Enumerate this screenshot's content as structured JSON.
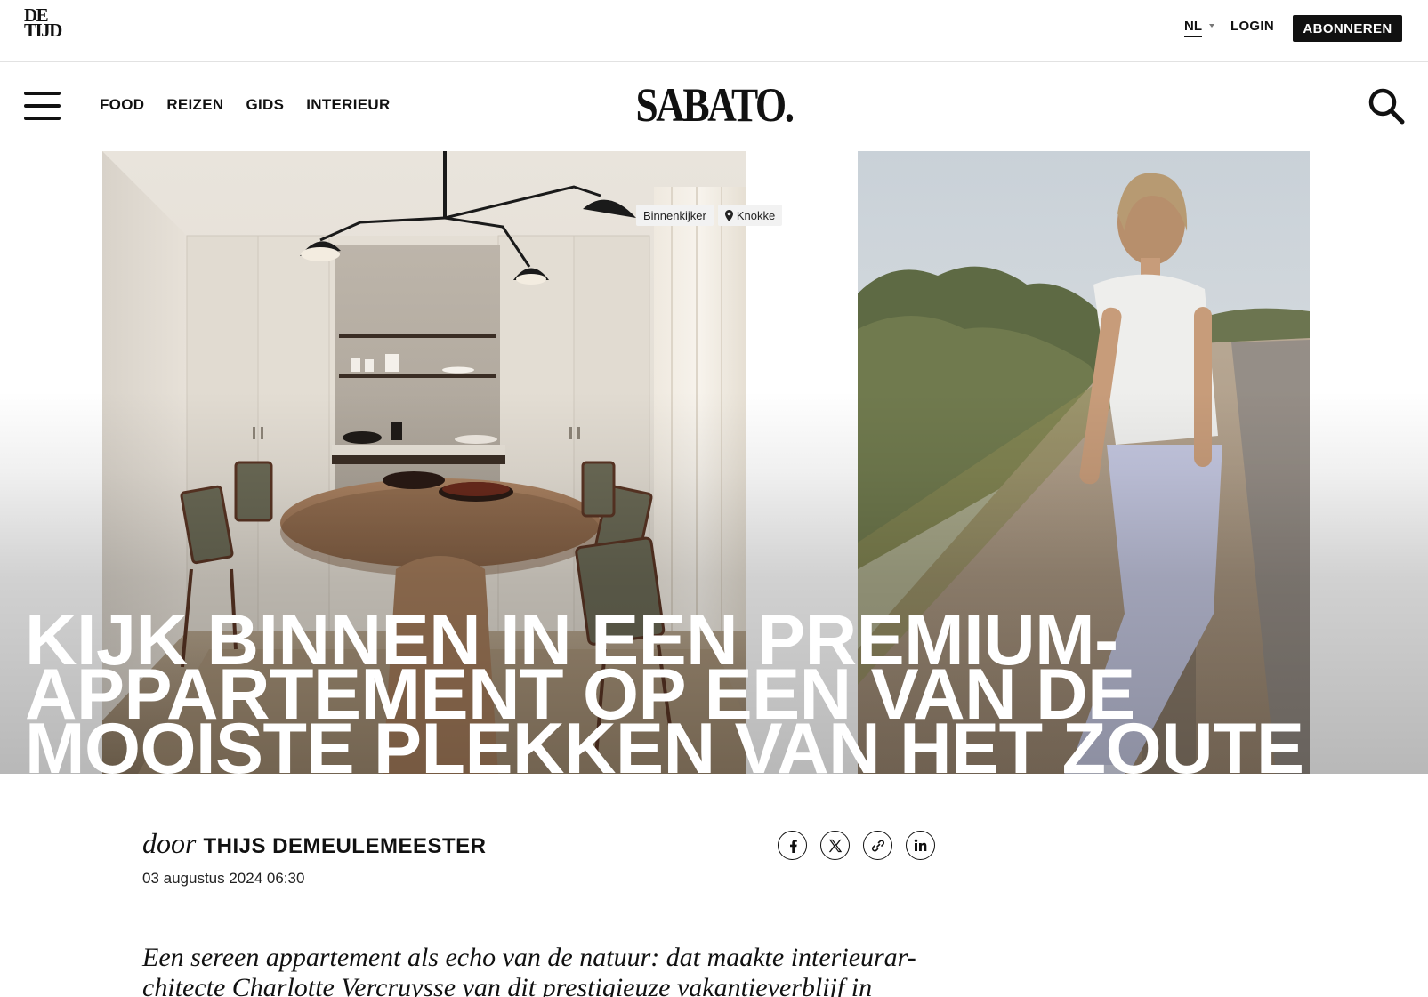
{
  "topbar": {
    "logo_line1": "DE",
    "logo_line2": "TIJD",
    "language": "NL",
    "login_label": "LOGIN",
    "subscribe_label": "ABONNEREN"
  },
  "nav": {
    "items": [
      {
        "label": "FOOD"
      },
      {
        "label": "REIZEN"
      },
      {
        "label": "GIDS"
      },
      {
        "label": "INTERIEUR"
      }
    ],
    "brand": "SABATO.",
    "menu_icon": "hamburger-icon",
    "search_icon": "search-icon"
  },
  "hero": {
    "tags": [
      {
        "label": "Binnenkijker"
      },
      {
        "label": "Knokke",
        "icon": "location-pin-icon"
      }
    ],
    "headline_lines": [
      "KIJK BINNEN IN EEN PREMIUM-",
      "APPARTEMENT OP EEN VAN DE",
      "MOOISTE PLEKKEN VAN HET ZOUTE"
    ]
  },
  "article": {
    "byline_prefix": "door",
    "author": "THIJS DEMEULEMEESTER",
    "date": "03 augustus 2024 06:30",
    "share": [
      {
        "icon": "facebook-icon"
      },
      {
        "icon": "x-icon"
      },
      {
        "icon": "link-icon"
      },
      {
        "icon": "linkedin-icon"
      }
    ],
    "intro_line1": "Een sereen appartement als echo van de natuur: dat maakte interieurar-",
    "intro_line2": "chitecte Charlotte Vercruysse van dit prestigieuze vakantieverblijf in"
  },
  "colors": {
    "text": "#111111",
    "button_bg": "#111111",
    "button_text": "#ffffff",
    "tag_bg": "#f2f2f2"
  }
}
